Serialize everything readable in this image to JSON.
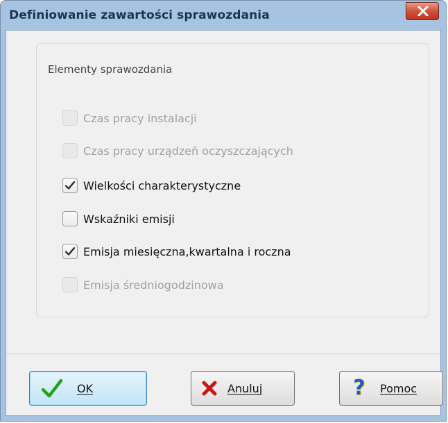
{
  "window": {
    "title": "Definiowanie zawartości sprawozdania"
  },
  "group": {
    "title": "Elementy sprawozdania",
    "items": [
      {
        "label": "Czas pracy instalacji",
        "checked": false,
        "enabled": false
      },
      {
        "label": "Czas pracy urządzeń oczyszczających",
        "checked": false,
        "enabled": false
      },
      {
        "label": "Wielkości charakterystyczne",
        "checked": true,
        "enabled": true
      },
      {
        "label": "Wskaźniki emisji",
        "checked": false,
        "enabled": true
      },
      {
        "label": "Emisja miesięczna,kwartalna i roczna",
        "checked": true,
        "enabled": true
      },
      {
        "label": "Emisja średniogodzinowa",
        "checked": false,
        "enabled": false
      }
    ]
  },
  "buttons": {
    "ok_label": "OK",
    "cancel_label": "Anuluj",
    "help_label": "Pomoc"
  },
  "icons": {
    "close": "close-icon",
    "ok": "checkmark-icon",
    "cancel": "red-x-icon",
    "help": "question-mark-icon"
  },
  "colors": {
    "title_text": "#1c3552",
    "frame": "#a6c3e2",
    "close_button": "#c1321e",
    "ok_check": "#22a316",
    "cancel_x": "#cc1414",
    "help_q": "#1e5bc6"
  }
}
